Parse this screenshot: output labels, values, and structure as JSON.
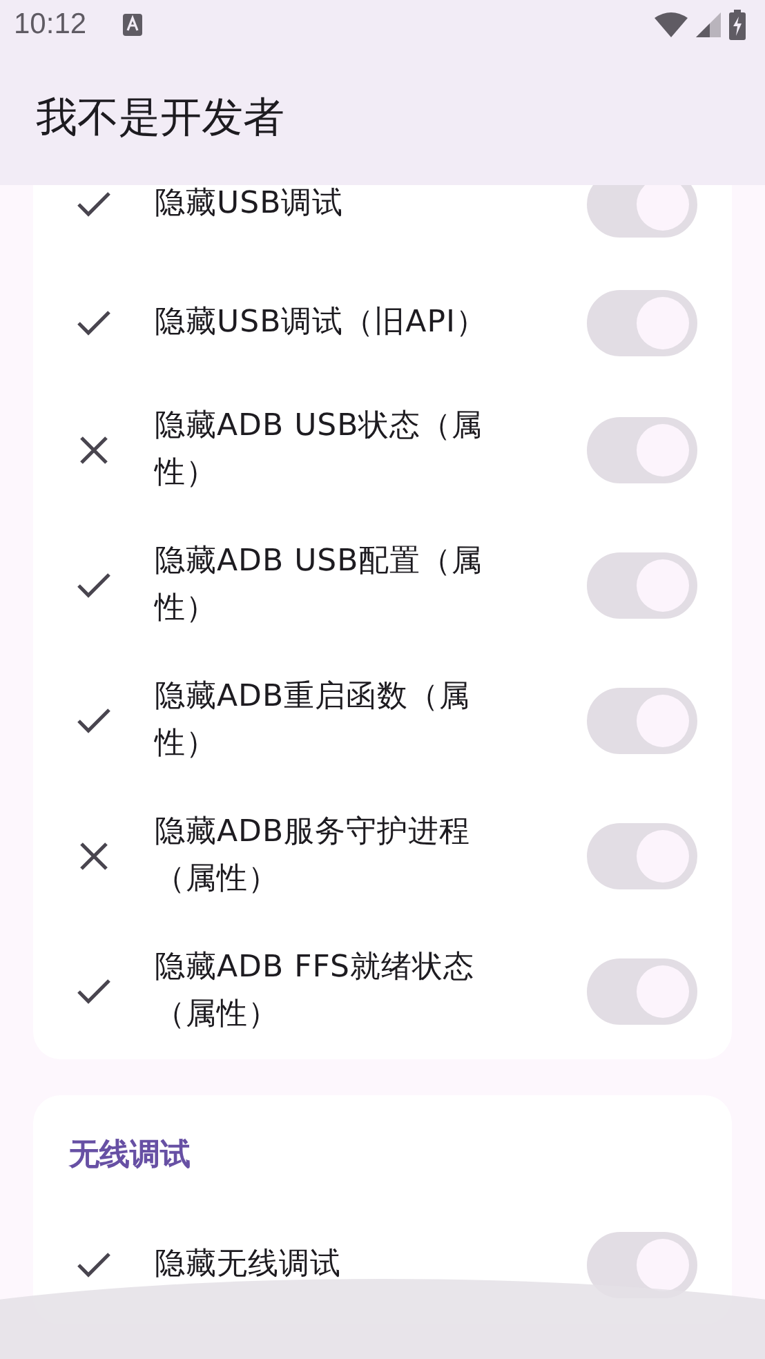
{
  "status_bar": {
    "time": "10:12"
  },
  "app_bar": {
    "title": "我不是开发者"
  },
  "sections": [
    {
      "items": [
        {
          "label": "隐藏USB调试",
          "ok": true,
          "on": true,
          "disabled": true
        },
        {
          "label": "隐藏USB调试（旧API）",
          "ok": true,
          "on": true,
          "disabled": true
        },
        {
          "label": "隐藏ADB USB状态（属性）",
          "ok": false,
          "on": true,
          "disabled": true
        },
        {
          "label": "隐藏ADB USB配置（属性）",
          "ok": true,
          "on": true,
          "disabled": true
        },
        {
          "label": "隐藏ADB重启函数（属性）",
          "ok": true,
          "on": true,
          "disabled": true
        },
        {
          "label": "隐藏ADB服务守护进程（属性）",
          "ok": false,
          "on": true,
          "disabled": true
        },
        {
          "label": "隐藏ADB FFS就绪状态（属性）",
          "ok": true,
          "on": true,
          "disabled": true
        }
      ]
    },
    {
      "title": "无线调试",
      "items": [
        {
          "label": "隐藏无线调试",
          "ok": true,
          "on": true,
          "disabled": true
        }
      ]
    }
  ]
}
